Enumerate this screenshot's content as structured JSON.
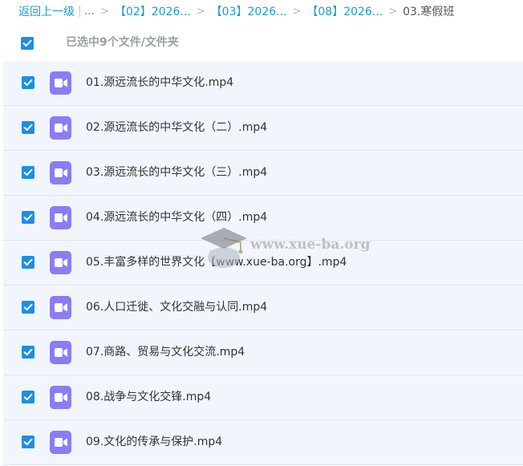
{
  "breadcrumb": {
    "back_label": "返回上一级",
    "pipe": "|",
    "ellipsis": "...",
    "separator": ">",
    "crumbs": [
      "【02】2026...",
      "【03】2026...",
      "【08】2026..."
    ],
    "current": "03.寒假班"
  },
  "selection": {
    "label": "已选中9个文件/文件夹",
    "all_checked": true
  },
  "files": [
    {
      "name": "01.源远流长的中华文化.mp4",
      "checked": true,
      "icon": "video-file-icon"
    },
    {
      "name": "02.源远流长的中华文化（二）.mp4",
      "checked": true,
      "icon": "video-file-icon"
    },
    {
      "name": "03.源远流长的中华文化（三）.mp4",
      "checked": true,
      "icon": "video-file-icon"
    },
    {
      "name": "04.源远流长的中华文化（四）.mp4",
      "checked": true,
      "icon": "video-file-icon"
    },
    {
      "name": "05.丰富多样的世界文化【www.xue-ba.org】.mp4",
      "checked": true,
      "icon": "video-file-icon"
    },
    {
      "name": "06.人口迁徙、文化交融与认同.mp4",
      "checked": true,
      "icon": "video-file-icon"
    },
    {
      "name": "07.商路、贸易与文化交流.mp4",
      "checked": true,
      "icon": "video-file-icon"
    },
    {
      "name": "08.战争与文化交锋.mp4",
      "checked": true,
      "icon": "video-file-icon"
    },
    {
      "name": "09.文化的传承与保护.mp4",
      "checked": true,
      "icon": "video-file-icon"
    }
  ],
  "watermark": {
    "text": "www.xue-ba.org",
    "icon": "graduation-cap-icon"
  },
  "colors": {
    "accent": "#1e8fe1",
    "link": "#1a9bd6",
    "video_icon": "#8b7cf6",
    "row_background": "#f0f6fc"
  }
}
